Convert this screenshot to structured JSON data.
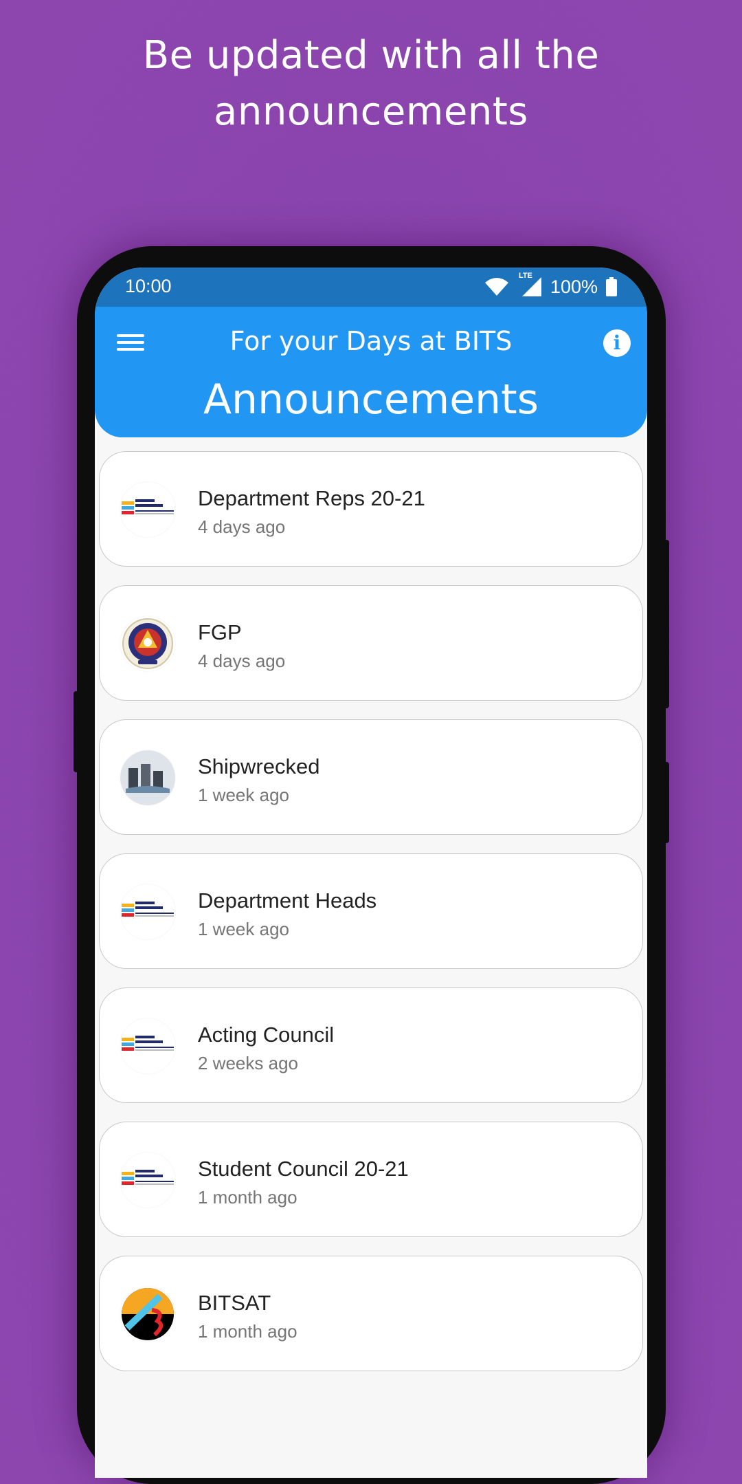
{
  "headline": {
    "line1": "Be updated with all the",
    "line2": "announcements"
  },
  "status_bar": {
    "time": "10:00",
    "network": "LTE",
    "battery": "100%"
  },
  "app_bar": {
    "subtitle": "For your Days at BITS",
    "title": "Announcements",
    "menu_icon": "hamburger-menu-icon",
    "info_icon": "info-icon",
    "colors": {
      "status": "#1e73bd",
      "bar": "#2196f3"
    }
  },
  "announcements": [
    {
      "title": "Department Reps 20-21",
      "time": "4 days ago",
      "logo": "election-commission"
    },
    {
      "title": "FGP",
      "time": "4 days ago",
      "logo": "bits-emblem"
    },
    {
      "title": "Shipwrecked",
      "time": "1 week ago",
      "logo": "shipwrecked"
    },
    {
      "title": "Department Heads",
      "time": "1 week ago",
      "logo": "election-commission"
    },
    {
      "title": "Acting Council",
      "time": "2 weeks ago",
      "logo": "election-commission"
    },
    {
      "title": "Student Council 20-21",
      "time": "1 month ago",
      "logo": "election-commission"
    },
    {
      "title": "BITSAT",
      "time": "1 month ago",
      "logo": "bitsat"
    }
  ],
  "background_color": "#8a44ad"
}
